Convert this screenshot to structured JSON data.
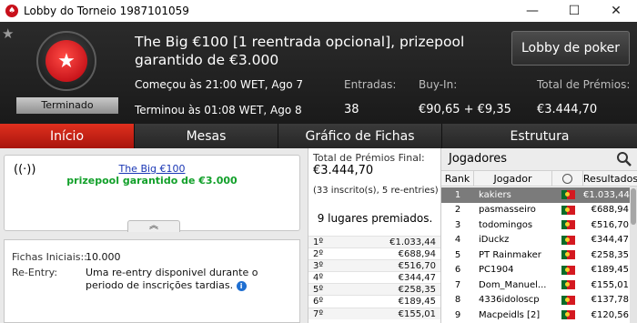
{
  "window": {
    "title": "Lobby do Torneio 1987101059",
    "controls": {
      "minimize": "—",
      "maximize": "☐",
      "close": "✕"
    }
  },
  "header": {
    "tournament_title": "The Big €100 [1 reentrada opcional], prizepool garantido de €3.000",
    "status": "Terminado",
    "lobby_button": "Lobby de poker",
    "start_text": "Começou às 21:00 WET, Ago 7",
    "end_text": "Terminou às 01:08 WET, Ago 8",
    "entries_label": "Entradas:",
    "entries_value": "38",
    "buyin_label": "Buy-In:",
    "buyin_value": "€90,65 + €9,35",
    "prize_label": "Total de Prémios:",
    "prize_value": "€3.444,70"
  },
  "tabs": [
    {
      "label": "Início",
      "active": true
    },
    {
      "label": "Mesas",
      "active": false
    },
    {
      "label": "Gráfico de Fichas",
      "active": false
    },
    {
      "label": "Estrutura",
      "active": false
    }
  ],
  "info": {
    "link": "The Big €100",
    "guarantee": "prizepool garantido de €3.000"
  },
  "details": {
    "chips_label": "Fichas Iniciais::",
    "chips_value": "10.000",
    "reentry_label": "Re-Entry:",
    "reentry_text": "Uma re-entry disponivel durante o periodo de inscrições tardias."
  },
  "prize_summary": {
    "label": "Total de Prémios Final:",
    "value": "€3.444,70",
    "entries_note": "(33 inscrito(s), 5 re-entries)",
    "places": "9 lugares premiados."
  },
  "payouts": [
    {
      "place": "1º",
      "amount": "€1.033,44"
    },
    {
      "place": "2º",
      "amount": "€688,94"
    },
    {
      "place": "3º",
      "amount": "€516,70"
    },
    {
      "place": "4º",
      "amount": "€344,47"
    },
    {
      "place": "5º",
      "amount": "€258,35"
    },
    {
      "place": "6º",
      "amount": "€189,45"
    },
    {
      "place": "7º",
      "amount": "€155,01"
    }
  ],
  "players_panel": {
    "title": "Jogadores",
    "col_rank": "Rank",
    "col_player": "Jogador",
    "col_results": "Resultados"
  },
  "players": [
    {
      "rank": "1",
      "name": "kakiers",
      "result": "€1.033,44",
      "selected": true
    },
    {
      "rank": "2",
      "name": "pasmasseiro",
      "result": "€688,94",
      "selected": false
    },
    {
      "rank": "3",
      "name": "todomingos",
      "result": "€516,70",
      "selected": false
    },
    {
      "rank": "4",
      "name": "iDuckz",
      "result": "€344,47",
      "selected": false
    },
    {
      "rank": "5",
      "name": "PT Rainmaker",
      "result": "€258,35",
      "selected": false
    },
    {
      "rank": "6",
      "name": "PC1904",
      "result": "€189,45",
      "selected": false
    },
    {
      "rank": "7",
      "name": "Dom_Manuel...",
      "result": "€155,01",
      "selected": false
    },
    {
      "rank": "8",
      "name": "4336idoloscp",
      "result": "€137,78",
      "selected": false
    },
    {
      "rank": "9",
      "name": "Macpeidls [2]",
      "result": "€120,56",
      "selected": false
    }
  ],
  "colors": {
    "brand_red": "#c8101b",
    "active_tab": "#d0281a",
    "guarantee_green": "#12a02a",
    "link_blue": "#1a37b5"
  }
}
